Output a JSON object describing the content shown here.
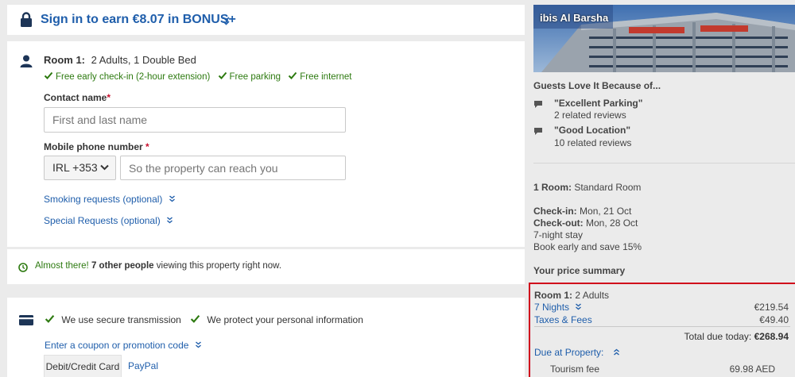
{
  "bonus_banner": {
    "text": "Sign in to earn €8.07 in BONUS+"
  },
  "room": {
    "title": "Room 1:",
    "details": "2 Adults, 1 Double Bed",
    "amenities": [
      "Free early check-in (2-hour extension)",
      "Free parking",
      "Free internet"
    ],
    "contact_label": "Contact name",
    "contact_placeholder": "First and last name",
    "phone_label": "Mobile phone number",
    "phone_country": "IRL +353",
    "phone_placeholder": "So the property can reach you",
    "smoking_link": "Smoking requests (optional)",
    "special_link": "Special Requests (optional)"
  },
  "urgency": {
    "prefix": "Almost there!",
    "highlight": "7 other people",
    "suffix": "viewing this property right now."
  },
  "payment": {
    "secure1": "We use secure transmission",
    "secure2": "We protect your personal information",
    "coupon_link": "Enter a coupon or promotion code",
    "tabs": [
      "Debit/Credit Card",
      "PayPal"
    ]
  },
  "hotel": {
    "name": "ibis Al Barsha",
    "guests_love_title": "Guests Love It Because of...",
    "reviews": [
      {
        "quote": "\"Excellent Parking\"",
        "count": "2 related reviews"
      },
      {
        "quote": "\"Good Location\"",
        "count": "10 related reviews"
      }
    ],
    "room_label": "1 Room:",
    "room_type": "Standard Room",
    "checkin_label": "Check-in:",
    "checkin_date": "Mon, 21 Oct",
    "checkout_label": "Check-out:",
    "checkout_date": "Mon, 28 Oct",
    "stay": "7-night stay",
    "promo": "Book early and save 15%",
    "price_title": "Your price summary"
  },
  "price_summary": {
    "room_label": "Room 1:",
    "room_value": "2 Adults",
    "nights_label": "7 Nights",
    "nights_amount": "€219.54",
    "taxes_label": "Taxes & Fees",
    "taxes_amount": "€49.40",
    "total_label": "Total due today:",
    "total_amount": "€268.94",
    "due_label": "Due at Property:",
    "tourism_label": "Tourism fee",
    "tourism_amount": "69.98 AED"
  },
  "colors": {
    "accent_blue": "#1f5eab",
    "success_green": "#2d7a10",
    "highlight_red": "#d0021b"
  }
}
